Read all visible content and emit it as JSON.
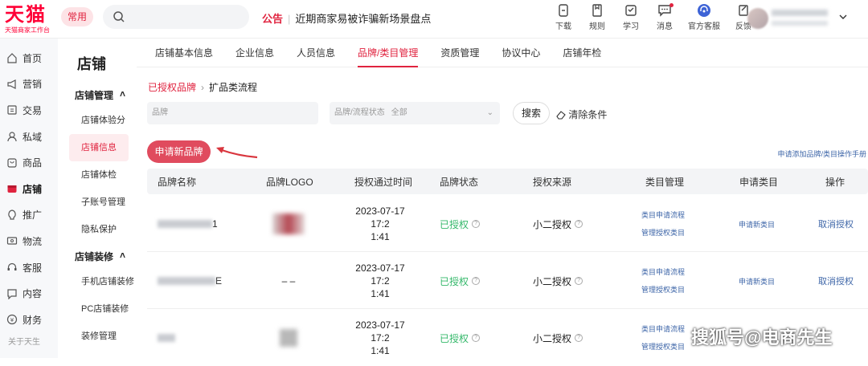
{
  "header": {
    "logo_main": "天猫",
    "logo_sub": "天猫商家工作台",
    "common_label": "常用",
    "search_placeholder": "",
    "notice_tag": "公告",
    "notice_text": "近期商家易被诈骗新场景盘点",
    "tools": [
      {
        "label": "下载",
        "icon": "download-icon"
      },
      {
        "label": "规则",
        "icon": "rules-icon"
      },
      {
        "label": "学习",
        "icon": "learn-icon"
      },
      {
        "label": "消息",
        "icon": "message-icon"
      },
      {
        "label": "官方客服",
        "icon": "customer-service-icon"
      },
      {
        "label": "反馈",
        "icon": "feedback-icon"
      }
    ]
  },
  "leftnav": {
    "items": [
      {
        "label": "首页",
        "icon": "home-icon"
      },
      {
        "label": "营销",
        "icon": "marketing-icon"
      },
      {
        "label": "交易",
        "icon": "trade-icon"
      },
      {
        "label": "私域",
        "icon": "private-domain-icon"
      },
      {
        "label": "商品",
        "icon": "product-icon"
      },
      {
        "label": "店铺",
        "icon": "store-icon",
        "active": true
      },
      {
        "label": "推广",
        "icon": "promotion-icon"
      },
      {
        "label": "物流",
        "icon": "logistics-icon"
      },
      {
        "label": "客服",
        "icon": "service-icon"
      },
      {
        "label": "内容",
        "icon": "content-icon"
      },
      {
        "label": "财务",
        "icon": "finance-icon"
      }
    ],
    "more": "关于天生"
  },
  "secnav": {
    "title": "店铺",
    "group1": "店铺管理",
    "group1_items": [
      "店铺体验分",
      "店铺信息",
      "店铺体检",
      "子账号管理",
      "隐私保护"
    ],
    "group2": "店铺装修",
    "group2_items": [
      "手机店铺装修",
      "PC店铺装修",
      "装修管理"
    ]
  },
  "tabs": [
    "店铺基本信息",
    "企业信息",
    "人员信息",
    "品牌/类目管理",
    "资质管理",
    "协议中心",
    "店铺年检"
  ],
  "breadcrumb": {
    "link": "已授权品牌",
    "current": "扩品类流程"
  },
  "filters": {
    "brand_label": "品牌",
    "status_label": "品牌/流程状态",
    "status_value": "全部",
    "search_button": "搜索",
    "clear_button": "清除条件"
  },
  "apply_button": "申请新品牌",
  "help_link": "申请添加品牌/类目操作手册",
  "table": {
    "headers": [
      "品牌名称",
      "品牌LOGO",
      "授权通过时间",
      "品牌状态",
      "授权来源",
      "类目管理",
      "申请类目",
      "操作"
    ],
    "rows": [
      {
        "name_tail": "1",
        "logo": "",
        "time_line1": "2023-07-17 17:2",
        "time_line2": "1:41",
        "status": "已授权",
        "source": "小二授权",
        "cat1": "类目申请流程",
        "cat2": "管理授权类目",
        "apply": "申请新类目",
        "op": "取消授权"
      },
      {
        "name_tail": "E",
        "logo": "– –",
        "time_line1": "2023-07-17 17:2",
        "time_line2": "1:41",
        "status": "已授权",
        "source": "小二授权",
        "cat1": "类目申请流程",
        "cat2": "管理授权类目",
        "apply": "申请新类目",
        "op": "取消授权"
      },
      {
        "name_tail": "",
        "logo": "",
        "time_line1": "2023-07-17 17:2",
        "time_line2": "1:41",
        "status": "已授权",
        "source": "小二授权",
        "cat1": "类目申请流程",
        "cat2": "管理授权类目",
        "apply": "",
        "op": ""
      }
    ]
  },
  "watermark": "搜狐号@电商先生"
}
